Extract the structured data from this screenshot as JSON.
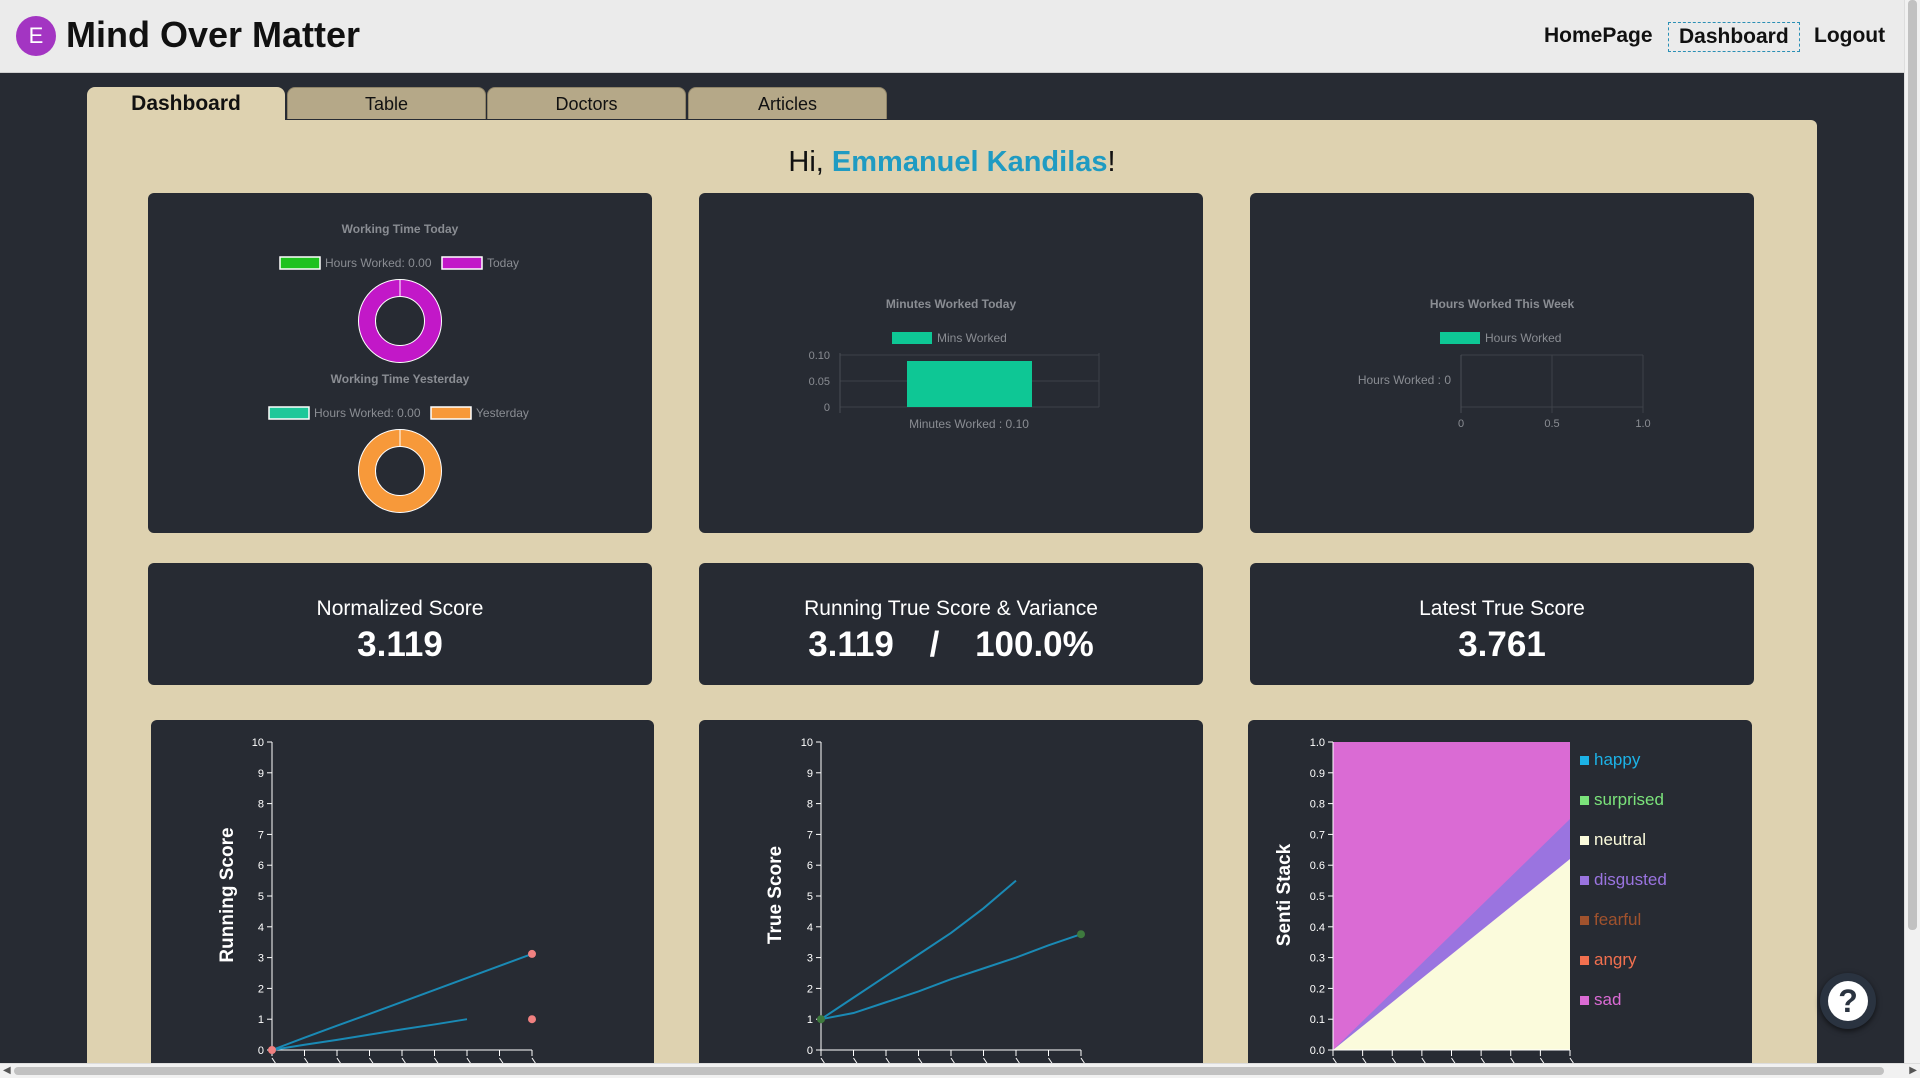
{
  "header": {
    "avatar_letter": "E",
    "app_title": "Mind Over Matter",
    "nav": {
      "home": "HomePage",
      "dashboard": "Dashboard",
      "logout": "Logout"
    }
  },
  "tabs": [
    "Dashboard",
    "Table",
    "Doctors",
    "Articles"
  ],
  "greeting": {
    "prefix": "Hi, ",
    "user": "Emmanuel Kandilas",
    "suffix": "!"
  },
  "stats": {
    "normalized": {
      "title": "Normalized Score",
      "value": "3.119"
    },
    "running": {
      "title": "Running True Score & Variance",
      "score": "3.119",
      "sep": "/",
      "variance": "100.0%"
    },
    "latest": {
      "title": "Latest True Score",
      "value": "3.761"
    }
  },
  "help_icon": "question-mark-icon",
  "chart_data": [
    {
      "type": "pie",
      "title": "Working Time Today",
      "legend": [
        "Hours Worked: 0.00",
        "Today"
      ],
      "values": [
        0,
        1
      ],
      "colors": [
        "#1ec21e",
        "#c218c8"
      ]
    },
    {
      "type": "pie",
      "title": "Working Time Yesterday",
      "legend": [
        "Hours Worked: 0.00",
        "Yesterday"
      ],
      "values": [
        0,
        1
      ],
      "colors": [
        "#1ec89a",
        "#f7993a"
      ]
    },
    {
      "type": "bar",
      "title": "Minutes Worked Today",
      "legend": [
        "Mins Worked"
      ],
      "categories": [
        "Minutes Worked : 0.10"
      ],
      "values": [
        0.1
      ],
      "ylim": [
        0,
        0.1
      ],
      "yticks": [
        "0",
        "0.05",
        "0.10"
      ],
      "color": "#0ec795"
    },
    {
      "type": "bar",
      "orientation": "horizontal",
      "title": "Hours Worked This Week",
      "legend": [
        "Hours Worked"
      ],
      "categories": [
        "Hours Worked : 0"
      ],
      "values": [
        0
      ],
      "xlim": [
        0,
        1
      ],
      "xticks": [
        "0",
        "0.5",
        "1.0"
      ],
      "color": "#0ec795"
    },
    {
      "type": "line",
      "ylabel": "Running Score",
      "ylim": [
        0,
        10
      ],
      "yticks": [
        "0",
        "1",
        "2",
        "3",
        "4",
        "5",
        "6",
        "7",
        "8",
        "9",
        "10"
      ],
      "x": [
        0,
        1,
        2,
        3,
        4,
        5,
        6,
        7,
        8
      ],
      "series": [
        {
          "values": [
            0,
            0.4,
            0.79,
            1.17,
            1.56,
            1.95,
            2.34,
            2.73,
            3.12
          ],
          "color": "#1a8ab5"
        },
        {
          "values": [
            0,
            0.17,
            0.33,
            0.5,
            0.67,
            0.83,
            1.0
          ],
          "color": "#1a8ab5"
        }
      ],
      "points": [
        [
          0,
          0
        ],
        [
          8,
          3.12
        ],
        [
          8,
          1.0
        ]
      ],
      "point_color": "#f08080"
    },
    {
      "type": "line",
      "ylabel": "True Score",
      "ylim": [
        0,
        10
      ],
      "yticks": [
        "0",
        "1",
        "2",
        "3",
        "4",
        "5",
        "6",
        "7",
        "8",
        "9",
        "10"
      ],
      "x": [
        0,
        1,
        2,
        3,
        4,
        5,
        6,
        7,
        8
      ],
      "series": [
        {
          "values": [
            1.0,
            1.7,
            2.4,
            3.1,
            3.8,
            4.6,
            5.5
          ],
          "color": "#1a8ab5"
        },
        {
          "values": [
            1.0,
            1.2,
            1.55,
            1.9,
            2.3,
            2.65,
            3.0,
            3.4,
            3.76
          ],
          "color": "#1a8ab5"
        }
      ],
      "points": [
        [
          0,
          1.0
        ],
        [
          8,
          3.76
        ]
      ],
      "point_color": "#3e7a3e"
    },
    {
      "type": "area",
      "ylabel": "Senti Stack",
      "ylim": [
        0,
        1
      ],
      "yticks": [
        "0.0",
        "0.1",
        "0.2",
        "0.3",
        "0.4",
        "0.5",
        "0.6",
        "0.7",
        "0.8",
        "0.9",
        "1.0"
      ],
      "legend_position": "right",
      "series": [
        {
          "name": "happy",
          "color": "#1cb2e6"
        },
        {
          "name": "surprised",
          "color": "#7be37b"
        },
        {
          "name": "neutral",
          "color": "#fbfbdc"
        },
        {
          "name": "disgusted",
          "color": "#9a74e0"
        },
        {
          "name": "fearful",
          "color": "#a0522d"
        },
        {
          "name": "angry",
          "color": "#f2704f"
        },
        {
          "name": "sad",
          "color": "#da6bd4"
        }
      ],
      "neutral_top_end": 0.62,
      "disgusted_top_end": 0.75
    }
  ]
}
